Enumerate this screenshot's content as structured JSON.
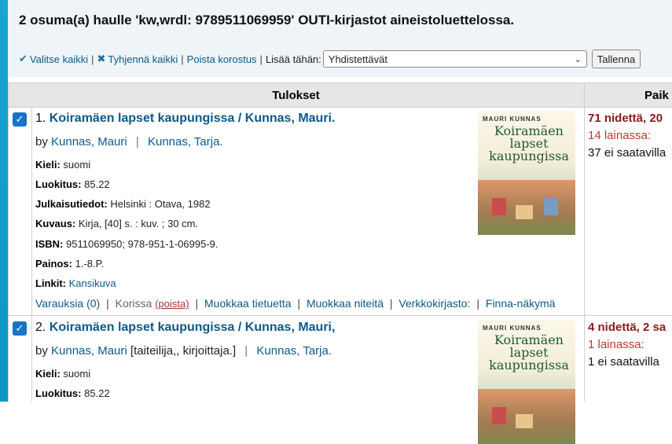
{
  "summary": "2 osuma(a) haulle 'kw,wrdl: 9789511069959' OUTI-kirjastot aineistoluettelossa.",
  "toolbar": {
    "select_all": "Valitse kaikki",
    "clear_all": "Tyhjennä kaikki",
    "remove_highlight": "Poista korostus",
    "add_to_label": "Lisää tähän:",
    "add_to_selected": "Yhdistettävät",
    "save_label": "Tallenna"
  },
  "headers": {
    "results": "Tulokset",
    "location": "Paik"
  },
  "results": [
    {
      "number": "1.",
      "title": "Koiramäen lapset kaupungissa / Kunnas, Mauri.",
      "by_prefix": "by",
      "author1": "Kunnas, Mauri",
      "author1_role": "",
      "author2": "Kunnas, Tarja.",
      "language_label": "Kieli:",
      "language": "suomi",
      "class_label": "Luokitus:",
      "class": "85.22",
      "publication_label": "Julkaisutiedot:",
      "publication": "Helsinki : Otava, 1982",
      "description_label": "Kuvaus:",
      "description": "Kirja, [40] s. : kuv. ; 30 cm.",
      "isbn_label": "ISBN:",
      "isbn": "9511069950; 978-951-1-06995-9.",
      "edition_label": "Painos:",
      "edition": "1.-8.P.",
      "links_label": "Linkit:",
      "links": "Kansikuva",
      "actions": {
        "holds": "Varauksia (0)",
        "cart": "Korissa",
        "cart_remove": "(poista)",
        "edit_record": "Muokkaa tietuetta",
        "edit_items": "Muokkaa niteitä",
        "web_library": "Verkkokirjasto:",
        "finna": "Finna-näkymä"
      },
      "cover": {
        "author": "MAURI KUNNAS",
        "title": "Koiramäen lapset kaupungissa"
      },
      "availability": {
        "total": "71 nidettä, 20",
        "on_loan": "14 lainassa:",
        "unavailable": "37 ei saatavilla"
      }
    },
    {
      "number": "2.",
      "title": "Koiramäen lapset kaupungissa / Kunnas, Mauri,",
      "by_prefix": "by",
      "author1": "Kunnas, Mauri",
      "author1_role": "[taiteilija,, kirjoittaja.]",
      "author2": "Kunnas, Tarja.",
      "language_label": "Kieli:",
      "language": "suomi",
      "class_label": "Luokitus:",
      "class": "85.22",
      "cover": {
        "author": "MAURI KUNNAS",
        "title": "Koiramäen lapset kaupungissa"
      },
      "availability": {
        "total": "4 nidettä, 2 sa",
        "on_loan": "1 lainassa:",
        "unavailable": "1 ei saatavilla"
      }
    }
  ],
  "colors": {
    "accent": "#1aa7d6",
    "link": "#0c5a8a",
    "checkbox": "#1a73c7",
    "availability_total": "#8b1a1a",
    "on_loan": "#c0392b"
  },
  "icons": {
    "select_all": "check-icon",
    "clear_all": "x-icon",
    "dropdown": "chevron-down-icon",
    "checkbox": "checkbox-checked-icon"
  }
}
